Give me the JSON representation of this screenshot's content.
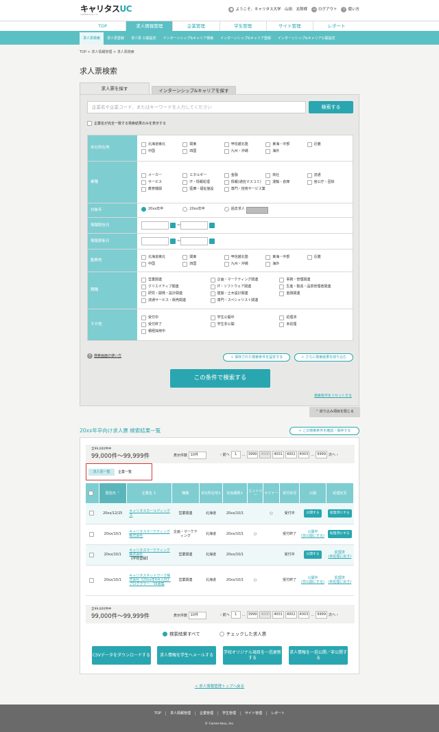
{
  "header": {
    "logo": "キャリタス",
    "logo_accent": "UC",
    "logo_sub": "CAREER-TASU UC",
    "welcome": "ようこそ、キャリタス大学　山田　太郎様",
    "logout": "ログアウト",
    "help": "使い方"
  },
  "gnav": [
    "TOP",
    "求人情報管理",
    "企業管理",
    "学生管理",
    "サイト管理",
    "レポート"
  ],
  "snav": [
    "求人票検索",
    "求人票登録",
    "求人票 公開設定",
    "インターンシップ&キャリア検索",
    "インターンシップ&キャリア登録",
    "インターンシップ&キャリア公開設定"
  ],
  "breadcrumb": "TOP > 求人情報管理 > 求人票検索",
  "page_title": "求人票検索",
  "tabs": [
    "求人票を探す",
    "インターンシップ&キャリアを探す"
  ],
  "search": {
    "placeholder": "企業名や企業コード、またはキーワードを入力してください",
    "button": "検索する",
    "exact": "企業名が完全一致する検索結果のみを表示する"
  },
  "criteria": {
    "honsha": {
      "label": "本社所在地",
      "options": [
        "北海道東北",
        "関東",
        "甲信越北陸",
        "東海・中部",
        "近畿",
        "中国",
        "四国",
        "九州・沖縄",
        "海外"
      ]
    },
    "gyoshu": {
      "label": "業種",
      "options": [
        "メーカー",
        "エネルギー",
        "金融",
        "商社",
        "流通",
        "サービス",
        "IT・情報処理",
        "情報(通信マスコミ)",
        "運輸・倉庫",
        "官公庁・団体",
        "教育機関",
        "医療・福祉施設",
        "専門・技術サービス業"
      ]
    },
    "taisho": {
      "label": "対象年",
      "options": [
        "20xx年卒",
        "20xx年卒",
        "過去求人"
      ]
    },
    "haishin": {
      "label": "情報配信日",
      "sep": "〜"
    },
    "koushin": {
      "label": "情報更新日",
      "sep": "〜"
    },
    "kinmu": {
      "label": "勤務地",
      "options": [
        "北海道東北",
        "関東",
        "甲信越北陸",
        "東海・中部",
        "近畿",
        "中国",
        "四国",
        "九州・沖縄",
        "海外"
      ]
    },
    "shokushu": {
      "label": "職種",
      "options": [
        "営業関連",
        "企画・マーケティング関連",
        "事務・管理関連",
        "クリエイティブ関連",
        "IT・ソフトウェア関連",
        "生産・製造・品質管理者関連",
        "研究・開発・設計関連",
        "建築・土木設計関連",
        "金融関連",
        "流通サービス・販売関連",
        "専門・スペシャリスト関連"
      ]
    },
    "sonota": {
      "label": "その他",
      "options": [
        "受付中",
        "学生公開中",
        "処理済",
        "受付終了",
        "学生非公開",
        "未処理",
        "積極採用中"
      ]
    }
  },
  "help_link": "検索画面の使い方",
  "save_cond": "＋ 保存された検索条件を設定する",
  "narrow_more": "＋ さらに検索結果を絞り込む",
  "submit": "この条件で検索する",
  "reset": "検索条件をリセットする",
  "close_narrow": "絞り込み項目を閉じる",
  "results": {
    "title": "20xx年卒向け求人票 検索結果一覧",
    "confirm_save": "＋ この検索条件を確認・保存する",
    "count_small": "全99,000件中",
    "count_big": "99,000件〜99,999件",
    "per_label": "表示件数",
    "per_value": "10件",
    "prev": "前へ",
    "next": "次へ",
    "pages": [
      "1",
      "3999",
      "4000",
      "4001",
      "4002",
      "4003",
      "9999"
    ],
    "subtab_active": "求人票一覧",
    "subtab_other": "企業一覧",
    "columns": [
      "配信日",
      "企業名",
      "職種",
      "本社所在地",
      "有効期限",
      "エントリー",
      "セミナー",
      "受付状況",
      "公開",
      "処理状況"
    ],
    "rows": [
      {
        "date": "20xx/12/25",
        "company": "キャリタスホールディングス",
        "company_note": "",
        "job": "営業関連",
        "pref": "北海道",
        "expire": "20xx/10/1",
        "entry": "",
        "seminar": "○",
        "status": "受付中",
        "pub_btn": "公開する",
        "pub_text": "",
        "proc_btn": "処理済にする",
        "proc_text": ""
      },
      {
        "date": "20xx/10/1",
        "company": "キャリタスマーケティング株式会社",
        "company_note": "",
        "job": "企画・マーケティング",
        "pref": "北海道",
        "expire": "20xx/10/1",
        "entry": "○",
        "seminar": "",
        "status": "受付終了",
        "pub_btn": "",
        "pub_text": "公開中",
        "pub_sub": "(非公開にする)",
        "proc_btn": "処理済にする",
        "proc_text": ""
      },
      {
        "date": "20xx/10/1",
        "company": "キャリタスマーケティング株式会社",
        "company_note": "【学校登録】",
        "job": "営業関連",
        "pref": "北海道",
        "expire": "20xx/10/1",
        "entry": "",
        "seminar": "",
        "status": "受付中",
        "pub_btn": "公開する",
        "pub_text": "",
        "proc_btn": "",
        "proc_text": "処理済",
        "proc_sub": "(未処理に戻す)"
      },
      {
        "date": "20xx/10/1",
        "company": "キャリタスネットワーク株式会社【20xx年4月入社】プログラマー／SE募集",
        "company_note": "",
        "job": "営業関連",
        "pref": "北海道",
        "expire": "20xx/10/1",
        "entry": "○",
        "seminar": "",
        "status": "受付終了",
        "pub_btn": "",
        "pub_text": "公開中",
        "pub_sub": "(非公開にする)",
        "proc_btn": "",
        "proc_text": "処理済",
        "proc_sub": "(未処理に戻す)"
      }
    ],
    "radio_all": "検索結果すべて",
    "radio_checked": "チェックした求人票",
    "actions": [
      "CSVデータをダウンロードする",
      "求人情報を学生へメールする",
      "学校オリジナル項目を一括更新する",
      "求人情報を一括公開／非公開する"
    ]
  },
  "back_link": "< 求人情報管理トップへ戻る",
  "footer": {
    "links": [
      "TOP",
      "求人情報管理",
      "企業管理",
      "学生管理",
      "サイト管理",
      "レポート"
    ],
    "copyright": "© Career-tasu, Inc."
  }
}
